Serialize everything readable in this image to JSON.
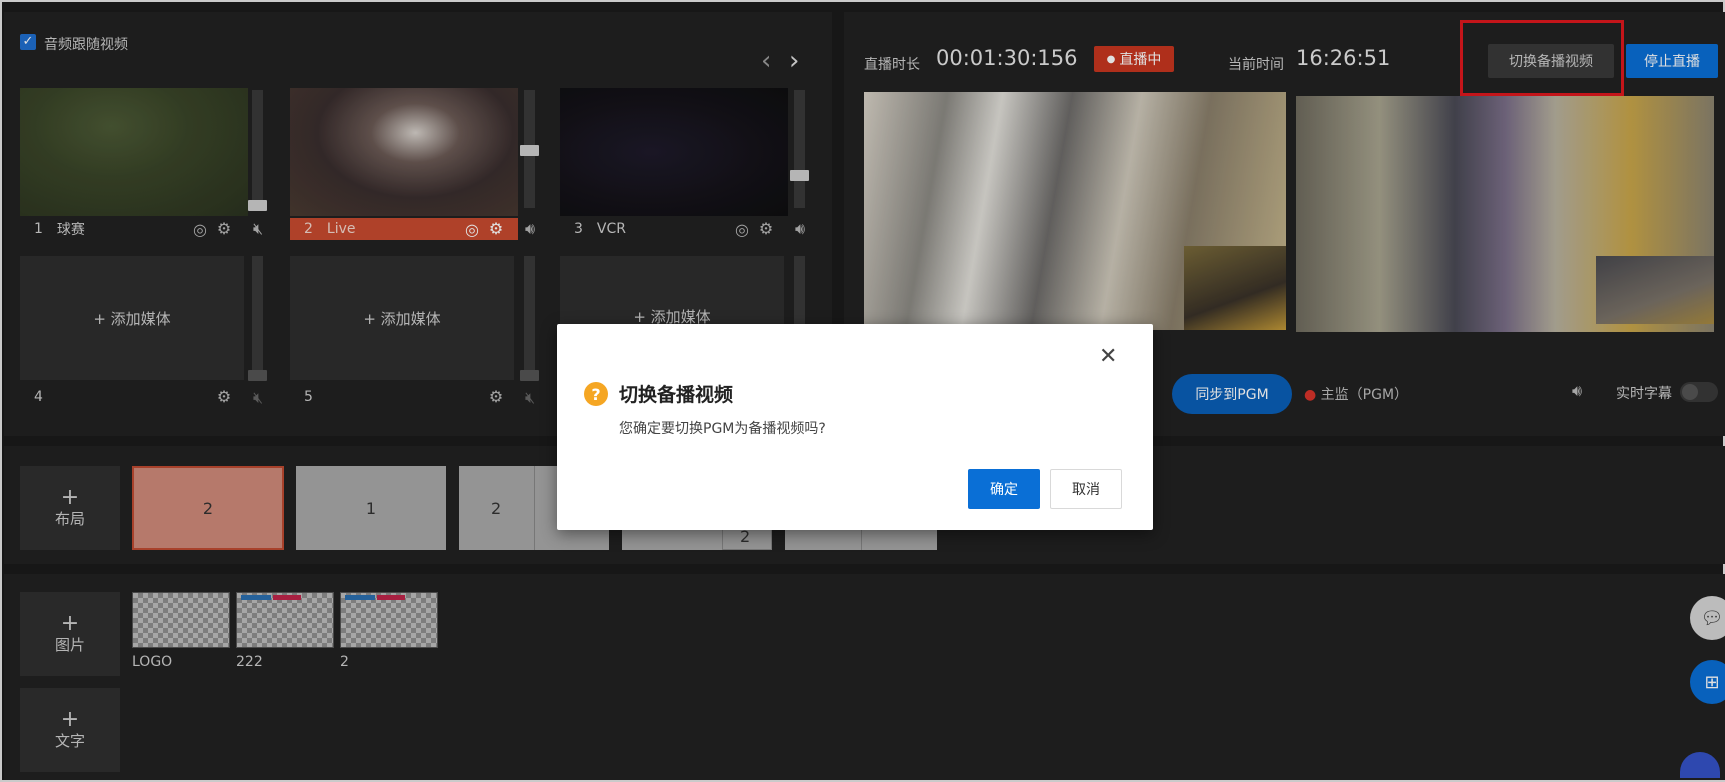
{
  "audio_follow": {
    "label": "音频跟随视频",
    "checked": true
  },
  "nav": {
    "prev": "‹",
    "next": "›"
  },
  "sources": [
    {
      "index": "1",
      "name": "球赛",
      "active": false
    },
    {
      "index": "2",
      "name": "Live",
      "active": true
    },
    {
      "index": "3",
      "name": "VCR",
      "active": false
    }
  ],
  "empty_slots": [
    {
      "index": "4",
      "label": "+ 添加媒体"
    },
    {
      "index": "5",
      "label": "+ 添加媒体"
    },
    {
      "index": "",
      "label": "+ 添加媒体"
    }
  ],
  "live": {
    "duration_label": "直播时长",
    "duration_value": "00:01:30:156",
    "status_badge": "直播中",
    "time_label": "当前时间",
    "time_value": "16:26:51",
    "switch_backup_button": "切换备播视频",
    "stop_button": "停止直播"
  },
  "monitor": {
    "sync_button": "同步到PGM",
    "main_monitor": "主监（PGM）",
    "subtitle_label": "实时字幕"
  },
  "layouts": {
    "add_label": "布局",
    "tiles": [
      "2",
      "1",
      "2",
      "2"
    ]
  },
  "images": {
    "add_label": "图片",
    "items": [
      {
        "name": "LOGO"
      },
      {
        "name": "222"
      },
      {
        "name": "2"
      }
    ]
  },
  "text_add_label": "文字",
  "dialog": {
    "title": "切换备播视频",
    "message": "您确定要切换PGM为备播视频吗?",
    "ok": "确定",
    "cancel": "取消",
    "close": "✕"
  },
  "colors": {
    "accent": "#0a6fd6",
    "live_red": "#c84b2f",
    "highlight_box": "#e0191e"
  }
}
